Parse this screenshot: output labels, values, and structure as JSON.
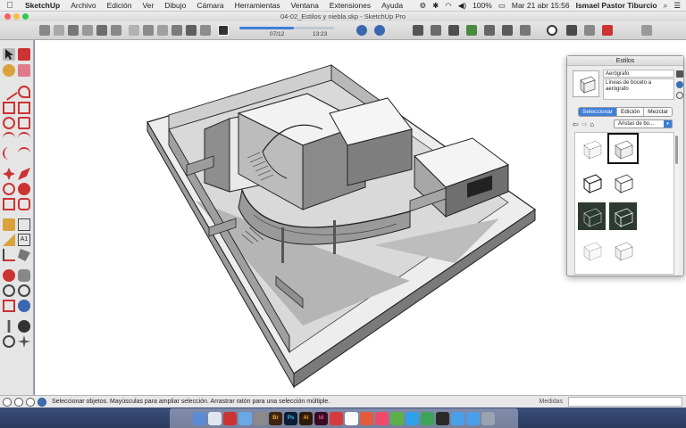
{
  "menubar": {
    "items": [
      "SketchUp",
      "Archivo",
      "Edición",
      "Ver",
      "Dibujo",
      "Cámara",
      "Herramientas",
      "Ventana",
      "Extensiones",
      "Ayuda"
    ],
    "battery": "100%",
    "datetime": "Mar 21 abr  15:56",
    "user": "Ismael Pastor Tiburcio"
  },
  "window": {
    "title": "04-02_Estilos y niebla.skp - SketchUp Pro"
  },
  "toolbar": {
    "scene_progress": 0.58,
    "scene_left_label": "07/12",
    "scene_right_label": "13:23"
  },
  "styles_panel": {
    "title": "Estilos",
    "style_name": "Aerógrafo",
    "style_description": "Líneas de boceto a aerógrafo",
    "tabs": [
      "Seleccionar",
      "Edición",
      "Mezclar"
    ],
    "active_tab": "Seleccionar",
    "collection": "Aristas de bo..."
  },
  "statusbar": {
    "message": "Seleccionar objetos. Mayúsculas para ampliar selección. Arrastrar ratón para una selección múltiple.",
    "measure_label": "Medidas",
    "measure_value": ""
  },
  "dock": {
    "apps": [
      "Br",
      "Ps",
      "Ai",
      "Id"
    ]
  }
}
